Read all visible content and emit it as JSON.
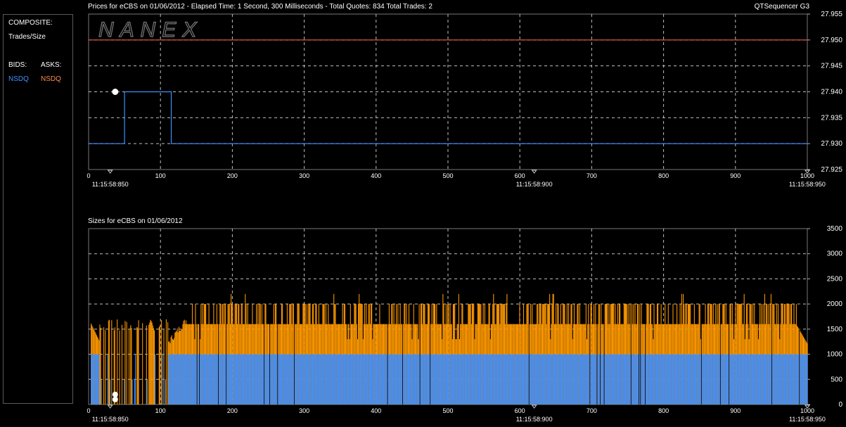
{
  "header": {
    "title": "Prices for  eCBS  on  01/06/2012  -  Elapsed Time: 1 Second, 300 Milliseconds  -  Total Quotes: 834  Total Trades: 2",
    "app": "QTSequencer G3",
    "sizes_title": "Sizes for  eCBS  on  01/06/2012"
  },
  "sidebar": {
    "composite": "COMPOSITE:",
    "trades": "Trades/Size",
    "bids": "BIDS:",
    "asks": "ASKS:",
    "bid_exchange": "NSDQ",
    "ask_exchange": "NSDQ"
  },
  "watermark": "NANEX",
  "colors": {
    "bid": "#3f8fff",
    "ask": "#ff9900",
    "ask_line": "#e8573a",
    "trade": "#ffffff",
    "grid": "#bfbfbf"
  },
  "chart_data": [
    {
      "type": "line",
      "name": "prices",
      "xlim": [
        0,
        1000
      ],
      "ylim": [
        27.925,
        27.955
      ],
      "x_ticks": [
        0,
        100,
        200,
        300,
        400,
        500,
        600,
        700,
        800,
        900,
        1000
      ],
      "y_ticks": [
        "27.925",
        "27.930",
        "27.935",
        "27.940",
        "27.945",
        "27.950",
        "27.955"
      ],
      "time_labels": [
        {
          "x": 30,
          "label": "11:15:58:850"
        },
        {
          "x": 620,
          "label": "11:15:58:900"
        },
        {
          "x": 1000,
          "label": "11:15:58:950"
        }
      ],
      "grid": true,
      "ask": {
        "price": 27.95
      },
      "bid": {
        "steps": [
          [
            0,
            27.93
          ],
          [
            50,
            27.94
          ],
          [
            115,
            27.93
          ],
          [
            1000,
            27.93
          ]
        ]
      },
      "trades": [
        {
          "x": 37,
          "price": 27.94
        }
      ]
    },
    {
      "type": "bar",
      "name": "sizes",
      "xlim": [
        0,
        1000
      ],
      "ylim": [
        0,
        3500
      ],
      "x_ticks": [
        0,
        100,
        200,
        300,
        400,
        500,
        600,
        700,
        800,
        900,
        1000
      ],
      "y_ticks": [
        "0",
        "500",
        "1000",
        "1500",
        "2000",
        "2500",
        "3000",
        "3500"
      ],
      "time_labels": [
        {
          "x": 30,
          "label": "11:15:58:850"
        },
        {
          "x": 620,
          "label": "11:15:58:900"
        },
        {
          "x": 1000,
          "label": "11:15:58:950"
        }
      ],
      "grid": true,
      "bid_size_typical": 1000,
      "ask_size_typical": 1600,
      "ask_size_peaks": [
        2000,
        2200
      ],
      "trades": [
        {
          "x": 37,
          "size": 200
        },
        {
          "x": 37,
          "size": 100
        }
      ]
    }
  ]
}
